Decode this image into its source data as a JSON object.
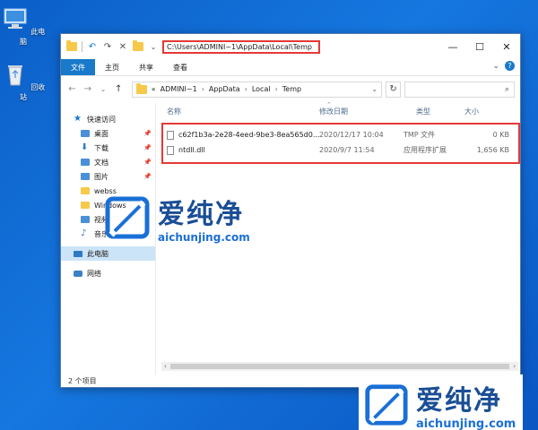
{
  "desktop": {
    "icons": [
      {
        "label": "此电脑",
        "icon": "computer-icon"
      },
      {
        "label": "回收站",
        "icon": "recycle-bin-icon"
      }
    ]
  },
  "window": {
    "title_path": "C:\\Users\\ADMINI~1\\AppData\\Local\\Temp",
    "controls": {
      "minimize": "—",
      "maximize": "☐",
      "close": "✕"
    },
    "ribbon_tabs": [
      "文件",
      "主页",
      "共享",
      "查看"
    ],
    "address": {
      "prefix": "«",
      "crumbs": [
        "ADMINI~1",
        "AppData",
        "Local",
        "Temp"
      ],
      "dropdown": "⌄"
    },
    "nav": {
      "back": "←",
      "forward": "→",
      "recent": "⌄",
      "up": "↑",
      "refresh": "↻",
      "search_icon": "⌕"
    },
    "sidebar": [
      {
        "label": "快速访问",
        "icon": "star-icon",
        "indent": false,
        "pinned": false
      },
      {
        "label": "桌面",
        "icon": "desktop-folder-icon",
        "indent": true,
        "pinned": true
      },
      {
        "label": "下载",
        "icon": "download-icon",
        "indent": true,
        "pinned": true
      },
      {
        "label": "文档",
        "icon": "documents-icon",
        "indent": true,
        "pinned": true
      },
      {
        "label": "图片",
        "icon": "pictures-icon",
        "indent": true,
        "pinned": true
      },
      {
        "label": "webss",
        "icon": "folder-icon",
        "indent": true,
        "pinned": false
      },
      {
        "label": "Windows",
        "icon": "folder-icon",
        "indent": true,
        "pinned": false
      },
      {
        "label": "视频",
        "icon": "videos-icon",
        "indent": true,
        "pinned": false
      },
      {
        "label": "音乐",
        "icon": "music-icon",
        "indent": true,
        "pinned": false
      },
      {
        "label": "此电脑",
        "icon": "this-pc-icon",
        "indent": false,
        "pinned": false,
        "selected": true
      },
      {
        "label": "网络",
        "icon": "network-icon",
        "indent": false,
        "pinned": false
      }
    ],
    "columns": {
      "name": "名称",
      "date": "修改日期",
      "type": "类型",
      "size": "大小"
    },
    "files": [
      {
        "name": "c62f1b3a-2e28-4eed-9be3-8ea565d0...",
        "date": "2020/12/17 10:04",
        "type": "TMP 文件",
        "size": "0 KB"
      },
      {
        "name": "ntdll.dll",
        "date": "2020/9/7 11:54",
        "type": "应用程序扩展",
        "size": "1,656 KB"
      }
    ],
    "status": "2 个项目"
  },
  "watermark": {
    "brand": "爱纯净",
    "url": "aichunjing.com"
  },
  "colors": {
    "highlight_box": "#e53935",
    "accent": "#1979ca",
    "desktop": "#0b5fc7"
  }
}
